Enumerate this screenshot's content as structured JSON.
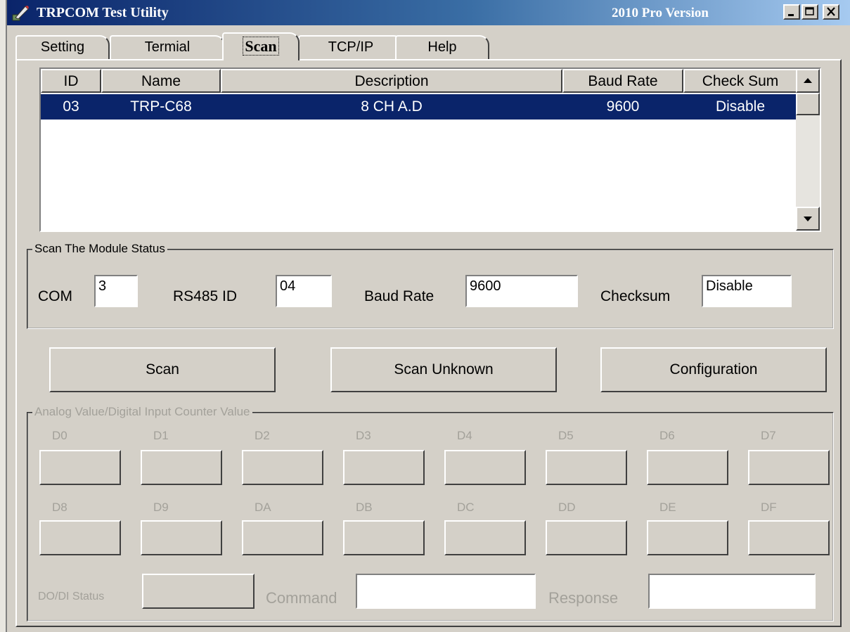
{
  "window": {
    "title": "TRPCOM Test Utility",
    "version": "2010 Pro Version",
    "app_icon": "pen-icon",
    "controls": [
      "minimize-icon",
      "maximize-icon",
      "close-icon"
    ]
  },
  "tabs": [
    {
      "label": "Setting",
      "active": false
    },
    {
      "label": "Termial",
      "active": false
    },
    {
      "label": "Scan",
      "active": true
    },
    {
      "label": "TCP/IP",
      "active": false
    },
    {
      "label": "Help",
      "active": false
    }
  ],
  "table": {
    "headers": [
      "ID",
      "Name",
      "Description",
      "Baud Rate",
      "Check Sum"
    ],
    "rows": [
      {
        "id": "03",
        "name": "TRP-C68",
        "description": "8 CH A.D",
        "baud_rate": "9600",
        "check_sum": "Disable",
        "selected": true
      }
    ]
  },
  "scan_status": {
    "group_label": "Scan The Module Status",
    "com_label": "COM",
    "com_value": "3",
    "id_label": "RS485 ID",
    "id_value": "04",
    "baud_label": "Baud Rate",
    "baud_value": "9600",
    "checksum_label": "Checksum",
    "checksum_value": "Disable"
  },
  "actions": {
    "scan": "Scan",
    "scan_unknown": "Scan Unknown",
    "configuration": "Configuration"
  },
  "values_group": {
    "label": "Analog Value/Digital Input Counter Value",
    "channels_row1": [
      "D0",
      "D1",
      "D2",
      "D3",
      "D4",
      "D5",
      "D6",
      "D7"
    ],
    "channels_row2": [
      "D8",
      "D9",
      "DA",
      "DB",
      "DC",
      "DD",
      "DE",
      "DF"
    ],
    "do_di_label": "DO/DI Status",
    "command_label": "Command",
    "command_value": "",
    "response_label": "Response",
    "response_value": ""
  },
  "colors": {
    "face": "#d4d0c8",
    "selection": "#0a246a",
    "title_start": "#0a246a",
    "title_end": "#a6caf0",
    "disabled_text": "#a3a19a"
  }
}
